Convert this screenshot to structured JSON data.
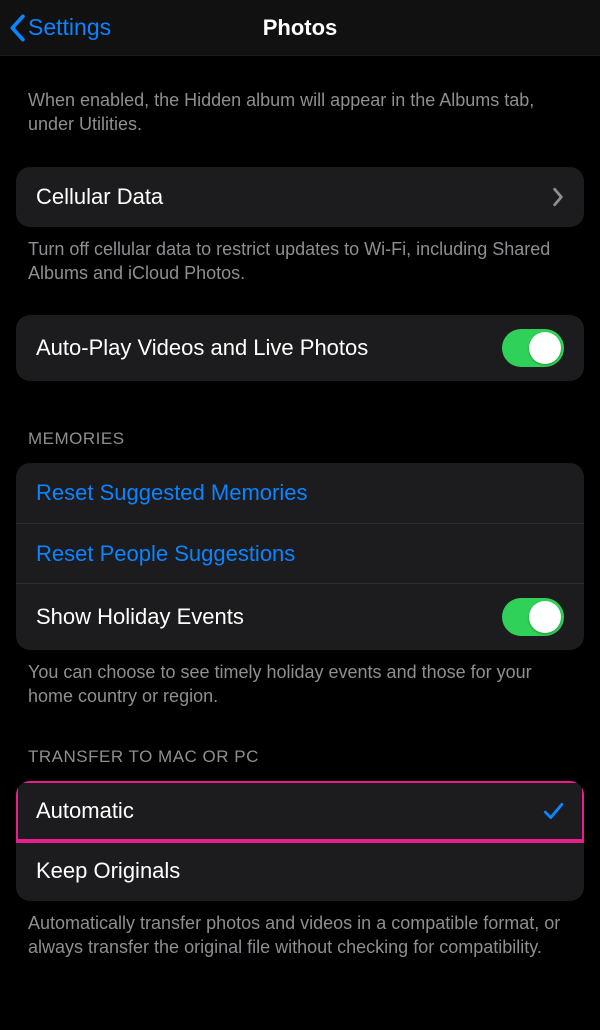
{
  "nav": {
    "back_label": "Settings",
    "title": "Photos"
  },
  "hidden_album_footer": "When enabled, the Hidden album will appear in the Albums tab, under Utilities.",
  "cellular": {
    "label": "Cellular Data",
    "footer": "Turn off cellular data to restrict updates to Wi-Fi, including Shared Albums and iCloud Photos."
  },
  "autoplay": {
    "label": "Auto-Play Videos and Live Photos"
  },
  "memories": {
    "header": "Memories",
    "reset_suggested": "Reset Suggested Memories",
    "reset_people": "Reset People Suggestions",
    "show_holiday": "Show Holiday Events",
    "footer": "You can choose to see timely holiday events and those for your home country or region."
  },
  "transfer": {
    "header": "Transfer to Mac or PC",
    "automatic": "Automatic",
    "keep_originals": "Keep Originals",
    "footer": "Automatically transfer photos and videos in a compatible format, or always transfer the original file without checking for compatibility."
  }
}
